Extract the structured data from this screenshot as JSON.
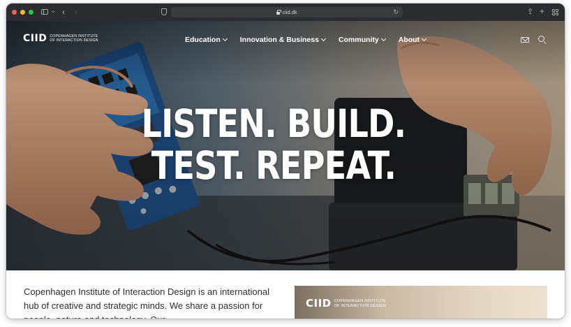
{
  "browser": {
    "url": "ciid.dk"
  },
  "site": {
    "logo_mark": "CIID",
    "logo_line1": "COPENHAGEN INSTITUTE",
    "logo_line2": "OF INTERACTION DESIGN",
    "nav": [
      {
        "label": "Education"
      },
      {
        "label": "Innovation & Business"
      },
      {
        "label": "Community"
      },
      {
        "label": "About"
      }
    ]
  },
  "hero": {
    "headline_line1": "LISTEN. BUILD.",
    "headline_line2": "TEST. REPEAT."
  },
  "intro": {
    "text": "Copenhagen Institute of Interaction Design is an international hub of creative and strategic minds. We share a passion for people, nature and technology. Our"
  },
  "promo": {
    "logo_mark": "CIID",
    "logo_line1": "COPENHAGEN INSTITUTE",
    "logo_line2": "OF INTERACTION DESIGN"
  },
  "colors": {
    "chrome": "#2b2c30",
    "address_bar": "#3a3b3f",
    "traffic_red": "#fe5f57",
    "traffic_yellow": "#febc2e",
    "traffic_green": "#28c840",
    "body_text": "#2e2e2e"
  }
}
